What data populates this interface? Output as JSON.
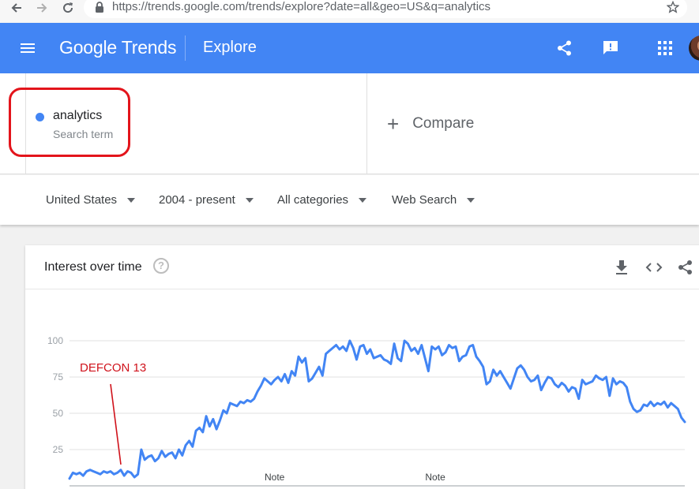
{
  "browser": {
    "url": "https://trends.google.com/trends/explore?date=all&geo=US&q=analytics"
  },
  "header": {
    "brand": "Google Trends",
    "title": "Explore"
  },
  "search_terms": [
    {
      "name": "analytics",
      "type": "Search term",
      "color": "#4285f4"
    }
  ],
  "compare_label": "Compare",
  "filters": {
    "region": "United States",
    "time": "2004 - present",
    "category": "All categories",
    "property": "Web Search"
  },
  "card": {
    "title": "Interest over time",
    "help": "?"
  },
  "annotation": {
    "label": "DEFCON 13",
    "color": "#d0121b"
  },
  "chart_data": {
    "type": "line",
    "title": "",
    "xlabel": "",
    "ylabel": "",
    "ylim": [
      0,
      100
    ],
    "yticks": [
      25,
      50,
      75,
      100
    ],
    "grid": true,
    "color": "#4285f4",
    "notes": [
      {
        "label": "Note",
        "index": 60
      },
      {
        "label": "Note",
        "index": 107
      }
    ],
    "series": [
      {
        "values": [
          5,
          9,
          8,
          9,
          7,
          10,
          11,
          10,
          9,
          8,
          10,
          9,
          10,
          8,
          9,
          11,
          7,
          10,
          9,
          6,
          8,
          25,
          18,
          20,
          21,
          17,
          19,
          24,
          20,
          22,
          23,
          19,
          25,
          21,
          28,
          31,
          27,
          38,
          40,
          37,
          48,
          41,
          46,
          39,
          45,
          52,
          50,
          57,
          56,
          55,
          58,
          57,
          59,
          58,
          60,
          65,
          69,
          74,
          72,
          70,
          73,
          75,
          72,
          77,
          71,
          79,
          76,
          89,
          85,
          88,
          72,
          74,
          78,
          82,
          76,
          91,
          93,
          95,
          97,
          94,
          96,
          93,
          100,
          95,
          87,
          96,
          97,
          91,
          94,
          88,
          89,
          90,
          87,
          86,
          84,
          98,
          88,
          86,
          100,
          98,
          93,
          95,
          91,
          97,
          88,
          79,
          96,
          94,
          96,
          90,
          92,
          97,
          95,
          96,
          86,
          89,
          90,
          96,
          97,
          89,
          86,
          82,
          70,
          72,
          80,
          76,
          79,
          75,
          71,
          67,
          74,
          81,
          83,
          80,
          75,
          72,
          73,
          76,
          66,
          71,
          75,
          74,
          70,
          68,
          71,
          69,
          65,
          68,
          67,
          60,
          73,
          70,
          71,
          72,
          76,
          74,
          73,
          75,
          62,
          74,
          70,
          72,
          71,
          68,
          58,
          53,
          51,
          52,
          56,
          55,
          58,
          55,
          57,
          56,
          58,
          54,
          57,
          55,
          53,
          47,
          44
        ]
      }
    ]
  }
}
